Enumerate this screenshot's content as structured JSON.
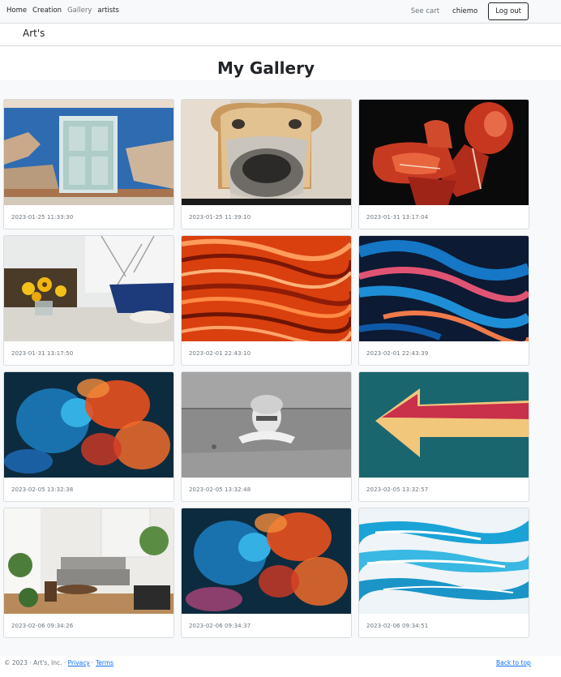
{
  "nav": {
    "links": [
      "Home",
      "Creation",
      "Gallery",
      "artists"
    ],
    "active": "Gallery",
    "see_cart": "See cart",
    "username": "chiemo",
    "logout": "Log out"
  },
  "brand": "Art's",
  "page_title": "My Gallery",
  "gallery": [
    {
      "date": "2023-01-25 11:33:30",
      "subject": "blue wall with white door"
    },
    {
      "date": "2023-01-25 11:39:10",
      "subject": "dog with bread slice on face"
    },
    {
      "date": "2023-01-31 13:17:04",
      "subject": "anatomical muscle figure"
    },
    {
      "date": "2023-01-31 13:17:50",
      "subject": "sunflowers by window"
    },
    {
      "date": "2023-02-01 22:43:10",
      "subject": "orange wavy abstract"
    },
    {
      "date": "2023-02-01 22:43:39",
      "subject": "blue pink marbled abstract"
    },
    {
      "date": "2023-02-05 13:32:38",
      "subject": "blue orange ink in water"
    },
    {
      "date": "2023-02-05 13:32:48",
      "subject": "statue bust on gray wall"
    },
    {
      "date": "2023-02-05 13:32:57",
      "subject": "arrow painted on teal wall"
    },
    {
      "date": "2023-02-06 09:34:26",
      "subject": "living room interior"
    },
    {
      "date": "2023-02-06 09:34:37",
      "subject": "blue orange ink in water"
    },
    {
      "date": "2023-02-06 09:34:51",
      "subject": "blue white water texture"
    }
  ],
  "footer": {
    "copyright": "© 2023 · Art's, Inc. ·",
    "privacy": "Privacy",
    "separator": "·",
    "terms": "Terms",
    "back_to_top": "Back to top"
  }
}
